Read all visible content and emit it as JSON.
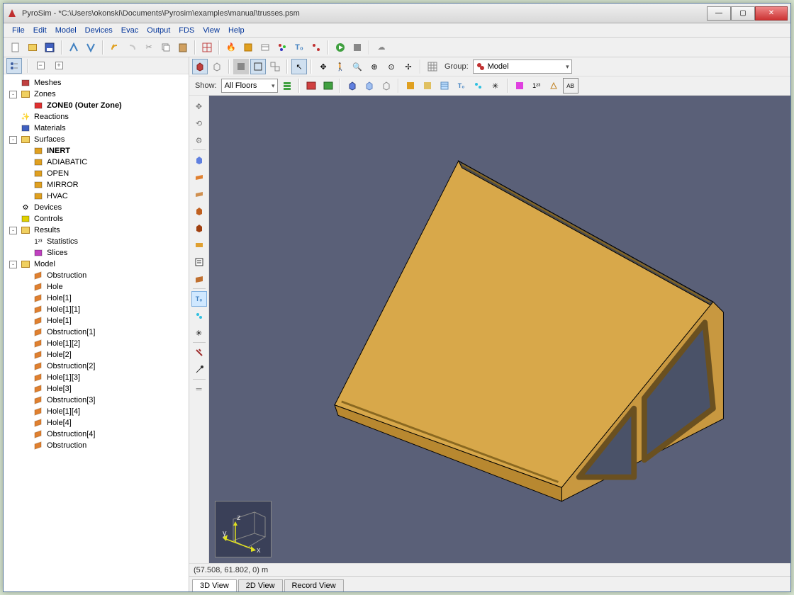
{
  "window": {
    "title": "PyroSim - *C:\\Users\\okonski\\Documents\\Pyrosim\\examples\\manual\\trusses.psm"
  },
  "menu": [
    "File",
    "Edit",
    "Model",
    "Devices",
    "Evac",
    "Output",
    "FDS",
    "View",
    "Help"
  ],
  "viewport_toolbar": {
    "group_label": "Group:",
    "group_value": "Model",
    "show_label": "Show:",
    "show_value": "All Floors"
  },
  "status": {
    "coords": "(57.508, 61.802, 0) m"
  },
  "tabs": [
    {
      "label": "3D View",
      "active": true
    },
    {
      "label": "2D View",
      "active": false
    },
    {
      "label": "Record View",
      "active": false
    }
  ],
  "tree": [
    {
      "depth": 0,
      "toggle": "",
      "icon": "mesh",
      "label": "Meshes",
      "bold": false,
      "color": "#c04040"
    },
    {
      "depth": 0,
      "toggle": "-",
      "icon": "folder",
      "label": "Zones",
      "bold": false,
      "color": "#e0a030"
    },
    {
      "depth": 1,
      "toggle": "",
      "icon": "zone",
      "label": "ZONE0 (Outer Zone)",
      "bold": true,
      "color": "#e03030"
    },
    {
      "depth": 0,
      "toggle": "",
      "icon": "spark",
      "label": "Reactions",
      "bold": false,
      "color": "#e0b000"
    },
    {
      "depth": 0,
      "toggle": "",
      "icon": "mat",
      "label": "Materials",
      "bold": false,
      "color": "#4060c0"
    },
    {
      "depth": 0,
      "toggle": "-",
      "icon": "folder",
      "label": "Surfaces",
      "bold": false,
      "color": "#40a0e0"
    },
    {
      "depth": 1,
      "toggle": "",
      "icon": "surf",
      "label": "INERT",
      "bold": true,
      "color": "#e0a020"
    },
    {
      "depth": 1,
      "toggle": "",
      "icon": "surf",
      "label": "ADIABATIC",
      "bold": false,
      "color": "#e0a020"
    },
    {
      "depth": 1,
      "toggle": "",
      "icon": "surf",
      "label": "OPEN",
      "bold": false,
      "color": "#e0a020"
    },
    {
      "depth": 1,
      "toggle": "",
      "icon": "surf",
      "label": "MIRROR",
      "bold": false,
      "color": "#e0a020"
    },
    {
      "depth": 1,
      "toggle": "",
      "icon": "surf",
      "label": "HVAC",
      "bold": false,
      "color": "#e0a020"
    },
    {
      "depth": 0,
      "toggle": "",
      "icon": "gear",
      "label": "Devices",
      "bold": false,
      "color": "#e0b000"
    },
    {
      "depth": 0,
      "toggle": "",
      "icon": "ctrl",
      "label": "Controls",
      "bold": false,
      "color": "#e0d000"
    },
    {
      "depth": 0,
      "toggle": "-",
      "icon": "folder",
      "label": "Results",
      "bold": false,
      "color": "#c03030"
    },
    {
      "depth": 1,
      "toggle": "",
      "icon": "stats",
      "label": "Statistics",
      "bold": false,
      "color": "#606060"
    },
    {
      "depth": 1,
      "toggle": "",
      "icon": "slice",
      "label": "Slices",
      "bold": false,
      "color": "#c040c0"
    },
    {
      "depth": 0,
      "toggle": "-",
      "icon": "folder",
      "label": "Model",
      "bold": false,
      "color": "#c03030"
    },
    {
      "depth": 1,
      "toggle": "",
      "icon": "obs",
      "label": "Obstruction",
      "bold": false,
      "color": "#e08030"
    },
    {
      "depth": 1,
      "toggle": "",
      "icon": "obs",
      "label": "Hole",
      "bold": false,
      "color": "#e08030"
    },
    {
      "depth": 1,
      "toggle": "",
      "icon": "obs",
      "label": "Hole[1]",
      "bold": false,
      "color": "#e08030"
    },
    {
      "depth": 1,
      "toggle": "",
      "icon": "obs",
      "label": "Hole[1][1]",
      "bold": false,
      "color": "#e08030"
    },
    {
      "depth": 1,
      "toggle": "",
      "icon": "obs",
      "label": "Hole[1]",
      "bold": false,
      "color": "#e08030"
    },
    {
      "depth": 1,
      "toggle": "",
      "icon": "obs",
      "label": "Obstruction[1]",
      "bold": false,
      "color": "#e08030"
    },
    {
      "depth": 1,
      "toggle": "",
      "icon": "obs",
      "label": "Hole[1][2]",
      "bold": false,
      "color": "#e08030"
    },
    {
      "depth": 1,
      "toggle": "",
      "icon": "obs",
      "label": "Hole[2]",
      "bold": false,
      "color": "#e08030"
    },
    {
      "depth": 1,
      "toggle": "",
      "icon": "obs",
      "label": "Obstruction[2]",
      "bold": false,
      "color": "#e08030"
    },
    {
      "depth": 1,
      "toggle": "",
      "icon": "obs",
      "label": "Hole[1][3]",
      "bold": false,
      "color": "#e08030"
    },
    {
      "depth": 1,
      "toggle": "",
      "icon": "obs",
      "label": "Hole[3]",
      "bold": false,
      "color": "#e08030"
    },
    {
      "depth": 1,
      "toggle": "",
      "icon": "obs",
      "label": "Obstruction[3]",
      "bold": false,
      "color": "#e08030"
    },
    {
      "depth": 1,
      "toggle": "",
      "icon": "obs",
      "label": "Hole[1][4]",
      "bold": false,
      "color": "#e08030"
    },
    {
      "depth": 1,
      "toggle": "",
      "icon": "obs",
      "label": "Hole[4]",
      "bold": false,
      "color": "#e08030"
    },
    {
      "depth": 1,
      "toggle": "",
      "icon": "obs",
      "label": "Obstruction[4]",
      "bold": false,
      "color": "#e08030"
    },
    {
      "depth": 1,
      "toggle": "",
      "icon": "obs",
      "label": "Obstruction",
      "bold": false,
      "color": "#e08030"
    }
  ]
}
